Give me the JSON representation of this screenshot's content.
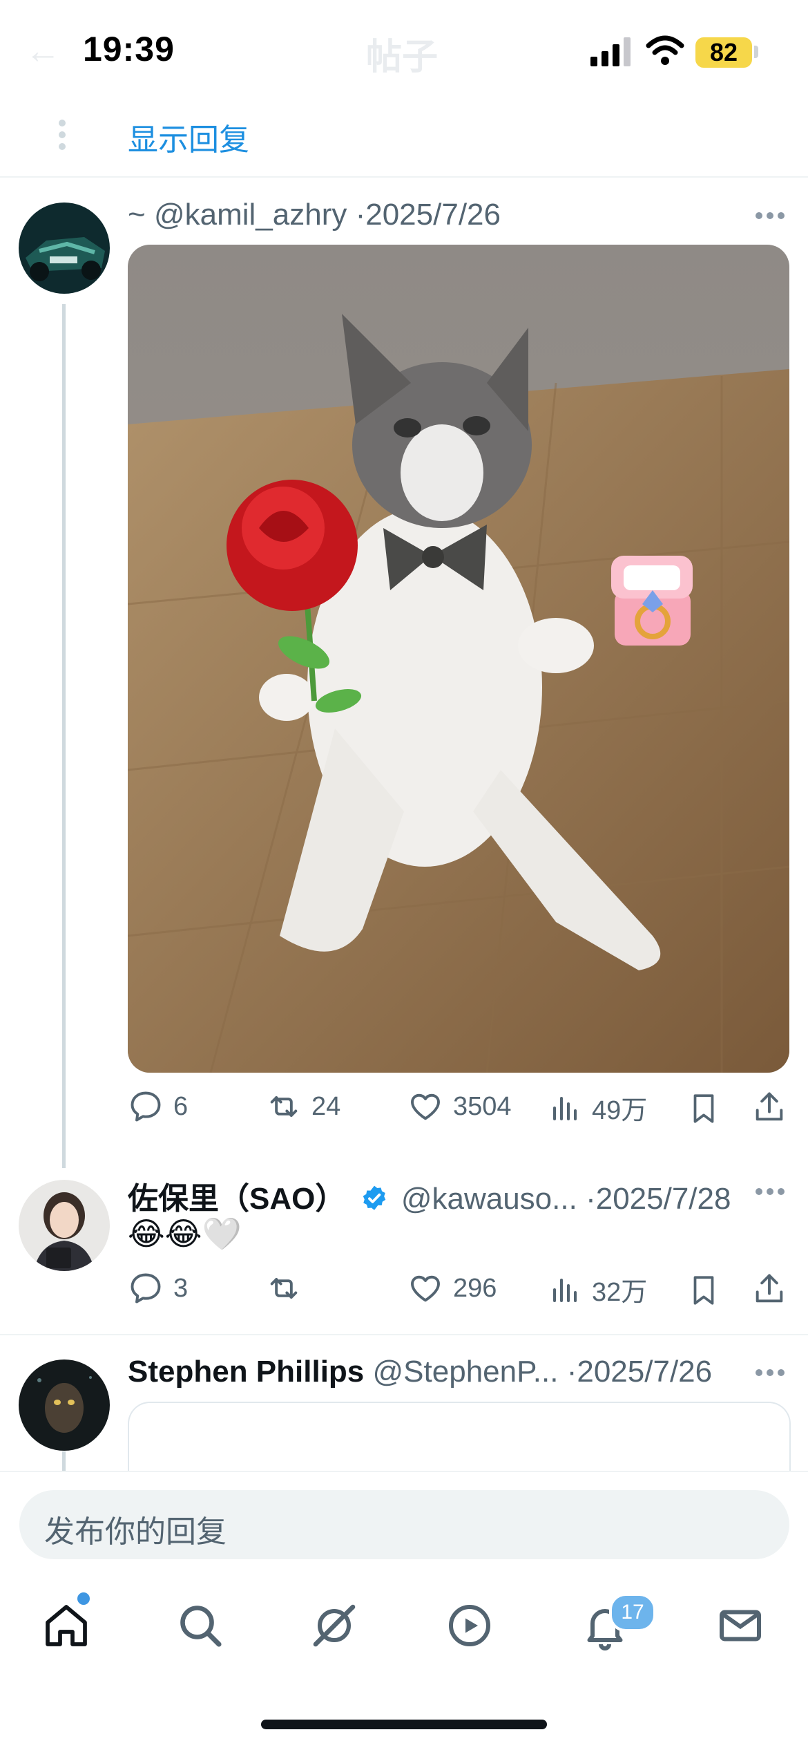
{
  "status_bar": {
    "time": "19:39",
    "battery": "82"
  },
  "header": {
    "title": "帖子",
    "show_replies_label": "显示回复"
  },
  "tweets": [
    {
      "prefix": "~",
      "handle": "@kamil_azhry",
      "date": "2025/7/26",
      "image_alt": "cat with bow tie holding rose and ring box",
      "actions": {
        "replies": "6",
        "retweets": "24",
        "likes": "3504",
        "views": "49万"
      }
    },
    {
      "name": "佐保里（SAO）",
      "verified": true,
      "handle": "@kawauso...",
      "date": "2025/7/28",
      "text": "😂😂🤍",
      "actions": {
        "replies": "3",
        "retweets": "",
        "likes": "296",
        "views": "32万"
      }
    },
    {
      "name": "Stephen Phillips",
      "handle": "@StephenP...",
      "date": "2025/7/26"
    }
  ],
  "compose": {
    "placeholder": "发布你的回复"
  },
  "tabbar": {
    "notifications_badge": "17"
  },
  "colors": {
    "accent": "#1d9bf0",
    "muted": "#536471",
    "text": "#0f1419"
  },
  "icons": [
    "home-icon",
    "search-icon",
    "grok-icon",
    "video-icon",
    "bell-icon",
    "mail-icon"
  ]
}
